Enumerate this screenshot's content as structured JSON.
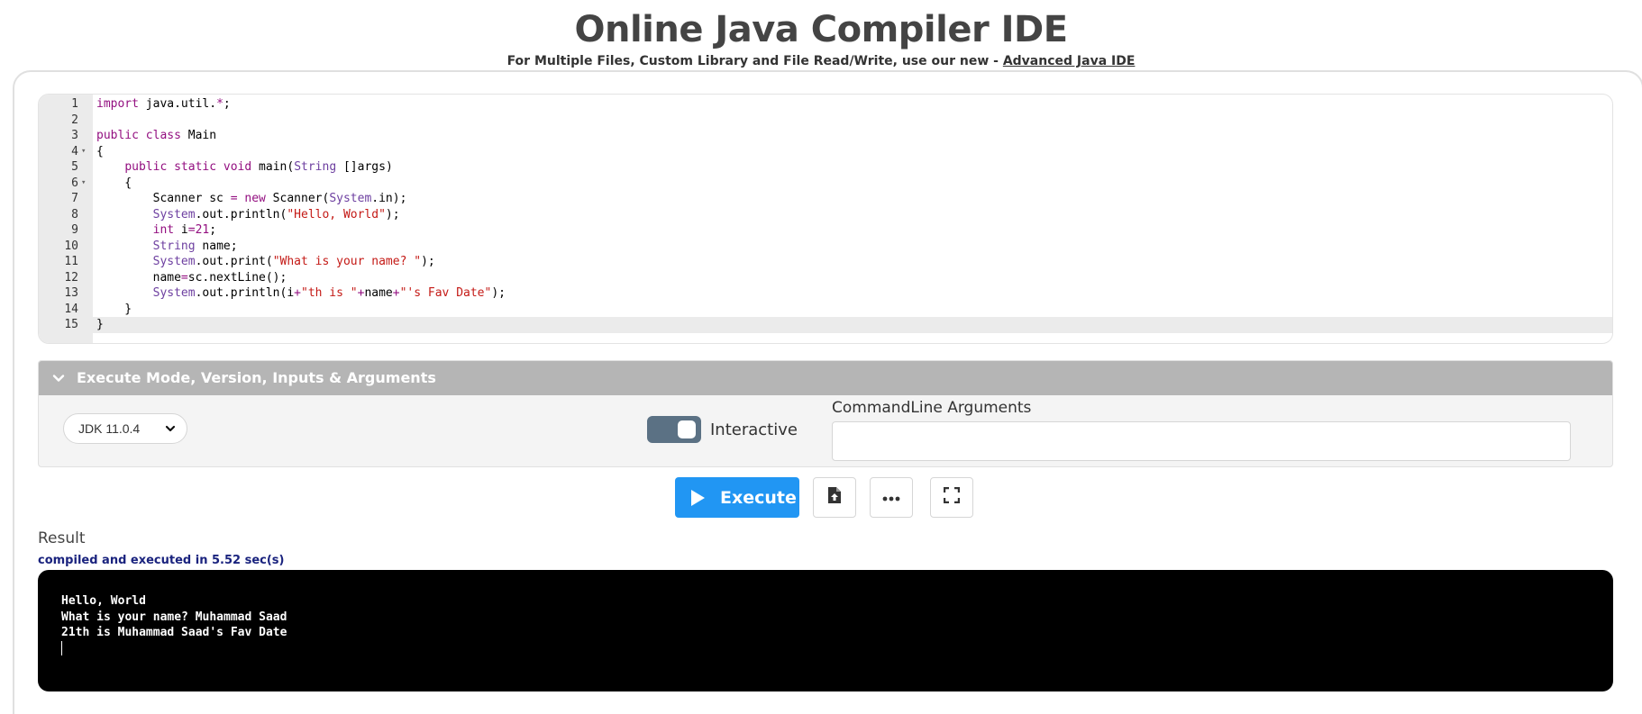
{
  "header": {
    "title": "Online Java Compiler IDE",
    "subtitle_prefix": "For Multiple Files, Custom Library and File Read/Write, use our new - ",
    "subtitle_link": "Advanced Java IDE"
  },
  "editor": {
    "active_line": 15,
    "lines": [
      {
        "n": "1",
        "fold": false,
        "segments": [
          {
            "t": "import",
            "c": "kw"
          },
          {
            "t": " java.util.",
            "c": ""
          },
          {
            "t": "*",
            "c": "kw"
          },
          {
            "t": ";",
            "c": ""
          }
        ]
      },
      {
        "n": "2",
        "fold": false,
        "segments": []
      },
      {
        "n": "3",
        "fold": false,
        "segments": [
          {
            "t": "public",
            "c": "kw"
          },
          {
            "t": " ",
            "c": ""
          },
          {
            "t": "class",
            "c": "kw"
          },
          {
            "t": " Main",
            "c": ""
          }
        ]
      },
      {
        "n": "4",
        "fold": true,
        "segments": [
          {
            "t": "{",
            "c": ""
          }
        ]
      },
      {
        "n": "5",
        "fold": false,
        "segments": [
          {
            "t": "    ",
            "c": ""
          },
          {
            "t": "public",
            "c": "kw"
          },
          {
            "t": " ",
            "c": ""
          },
          {
            "t": "static",
            "c": "kw"
          },
          {
            "t": " ",
            "c": ""
          },
          {
            "t": "void",
            "c": "kw"
          },
          {
            "t": " main(",
            "c": ""
          },
          {
            "t": "String",
            "c": "ty"
          },
          {
            "t": " []args)",
            "c": ""
          }
        ]
      },
      {
        "n": "6",
        "fold": true,
        "segments": [
          {
            "t": "    {",
            "c": ""
          }
        ]
      },
      {
        "n": "7",
        "fold": false,
        "segments": [
          {
            "t": "        Scanner sc ",
            "c": ""
          },
          {
            "t": "=",
            "c": "kw"
          },
          {
            "t": " ",
            "c": ""
          },
          {
            "t": "new",
            "c": "kw"
          },
          {
            "t": " Scanner(",
            "c": ""
          },
          {
            "t": "System",
            "c": "ty"
          },
          {
            "t": ".in);",
            "c": ""
          }
        ]
      },
      {
        "n": "8",
        "fold": false,
        "segments": [
          {
            "t": "        ",
            "c": ""
          },
          {
            "t": "System",
            "c": "ty"
          },
          {
            "t": ".out.println(",
            "c": ""
          },
          {
            "t": "\"Hello, World\"",
            "c": "st"
          },
          {
            "t": ");",
            "c": ""
          }
        ]
      },
      {
        "n": "9",
        "fold": false,
        "segments": [
          {
            "t": "        ",
            "c": ""
          },
          {
            "t": "int",
            "c": "kw"
          },
          {
            "t": " i",
            "c": ""
          },
          {
            "t": "=",
            "c": "kw"
          },
          {
            "t": "21",
            "c": "kw"
          },
          {
            "t": ";",
            "c": ""
          }
        ]
      },
      {
        "n": "10",
        "fold": false,
        "segments": [
          {
            "t": "        ",
            "c": ""
          },
          {
            "t": "String",
            "c": "ty"
          },
          {
            "t": " name;",
            "c": ""
          }
        ]
      },
      {
        "n": "11",
        "fold": false,
        "segments": [
          {
            "t": "        ",
            "c": ""
          },
          {
            "t": "System",
            "c": "ty"
          },
          {
            "t": ".out.print(",
            "c": ""
          },
          {
            "t": "\"What is your name? \"",
            "c": "st"
          },
          {
            "t": ");",
            "c": ""
          }
        ]
      },
      {
        "n": "12",
        "fold": false,
        "segments": [
          {
            "t": "        name",
            "c": ""
          },
          {
            "t": "=",
            "c": "kw"
          },
          {
            "t": "sc.nextLine();",
            "c": ""
          }
        ]
      },
      {
        "n": "13",
        "fold": false,
        "segments": [
          {
            "t": "        ",
            "c": ""
          },
          {
            "t": "System",
            "c": "ty"
          },
          {
            "t": ".out.println(i",
            "c": ""
          },
          {
            "t": "+",
            "c": "kw"
          },
          {
            "t": "\"th is \"",
            "c": "st"
          },
          {
            "t": "+",
            "c": "kw"
          },
          {
            "t": "name",
            "c": ""
          },
          {
            "t": "+",
            "c": "kw"
          },
          {
            "t": "\"'s Fav Date\"",
            "c": "st"
          },
          {
            "t": ");",
            "c": ""
          }
        ]
      },
      {
        "n": "14",
        "fold": false,
        "segments": [
          {
            "t": "    }",
            "c": ""
          }
        ]
      },
      {
        "n": "15",
        "fold": false,
        "segments": [
          {
            "t": "}",
            "c": ""
          }
        ]
      }
    ]
  },
  "execute_panel": {
    "header": "Execute Mode, Version, Inputs & Arguments",
    "version": "JDK 11.0.4",
    "interactive_label": "Interactive",
    "interactive_on": true,
    "args_label": "CommandLine Arguments",
    "args_value": ""
  },
  "toolbar": {
    "execute_label": "Execute"
  },
  "result": {
    "label": "Result",
    "status": "compiled and executed in 5.52 sec(s)",
    "output": [
      "Hello, World",
      "What is your name? Muhammad Saad",
      "21th is Muhammad Saad's Fav Date"
    ]
  },
  "icons": {
    "collapse": "chevron-down-icon",
    "version_dropdown": "chevron-down-icon",
    "execute": "play-icon",
    "upload": "file-upload-icon",
    "more": "more-horizontal-icon",
    "fullscreen": "fullscreen-icon"
  },
  "colors": {
    "accent": "#2196f3",
    "panel_header": "#b5b5b5",
    "toggle": "#5b7184",
    "status_text": "#1a237e",
    "terminal_bg": "#000000"
  }
}
